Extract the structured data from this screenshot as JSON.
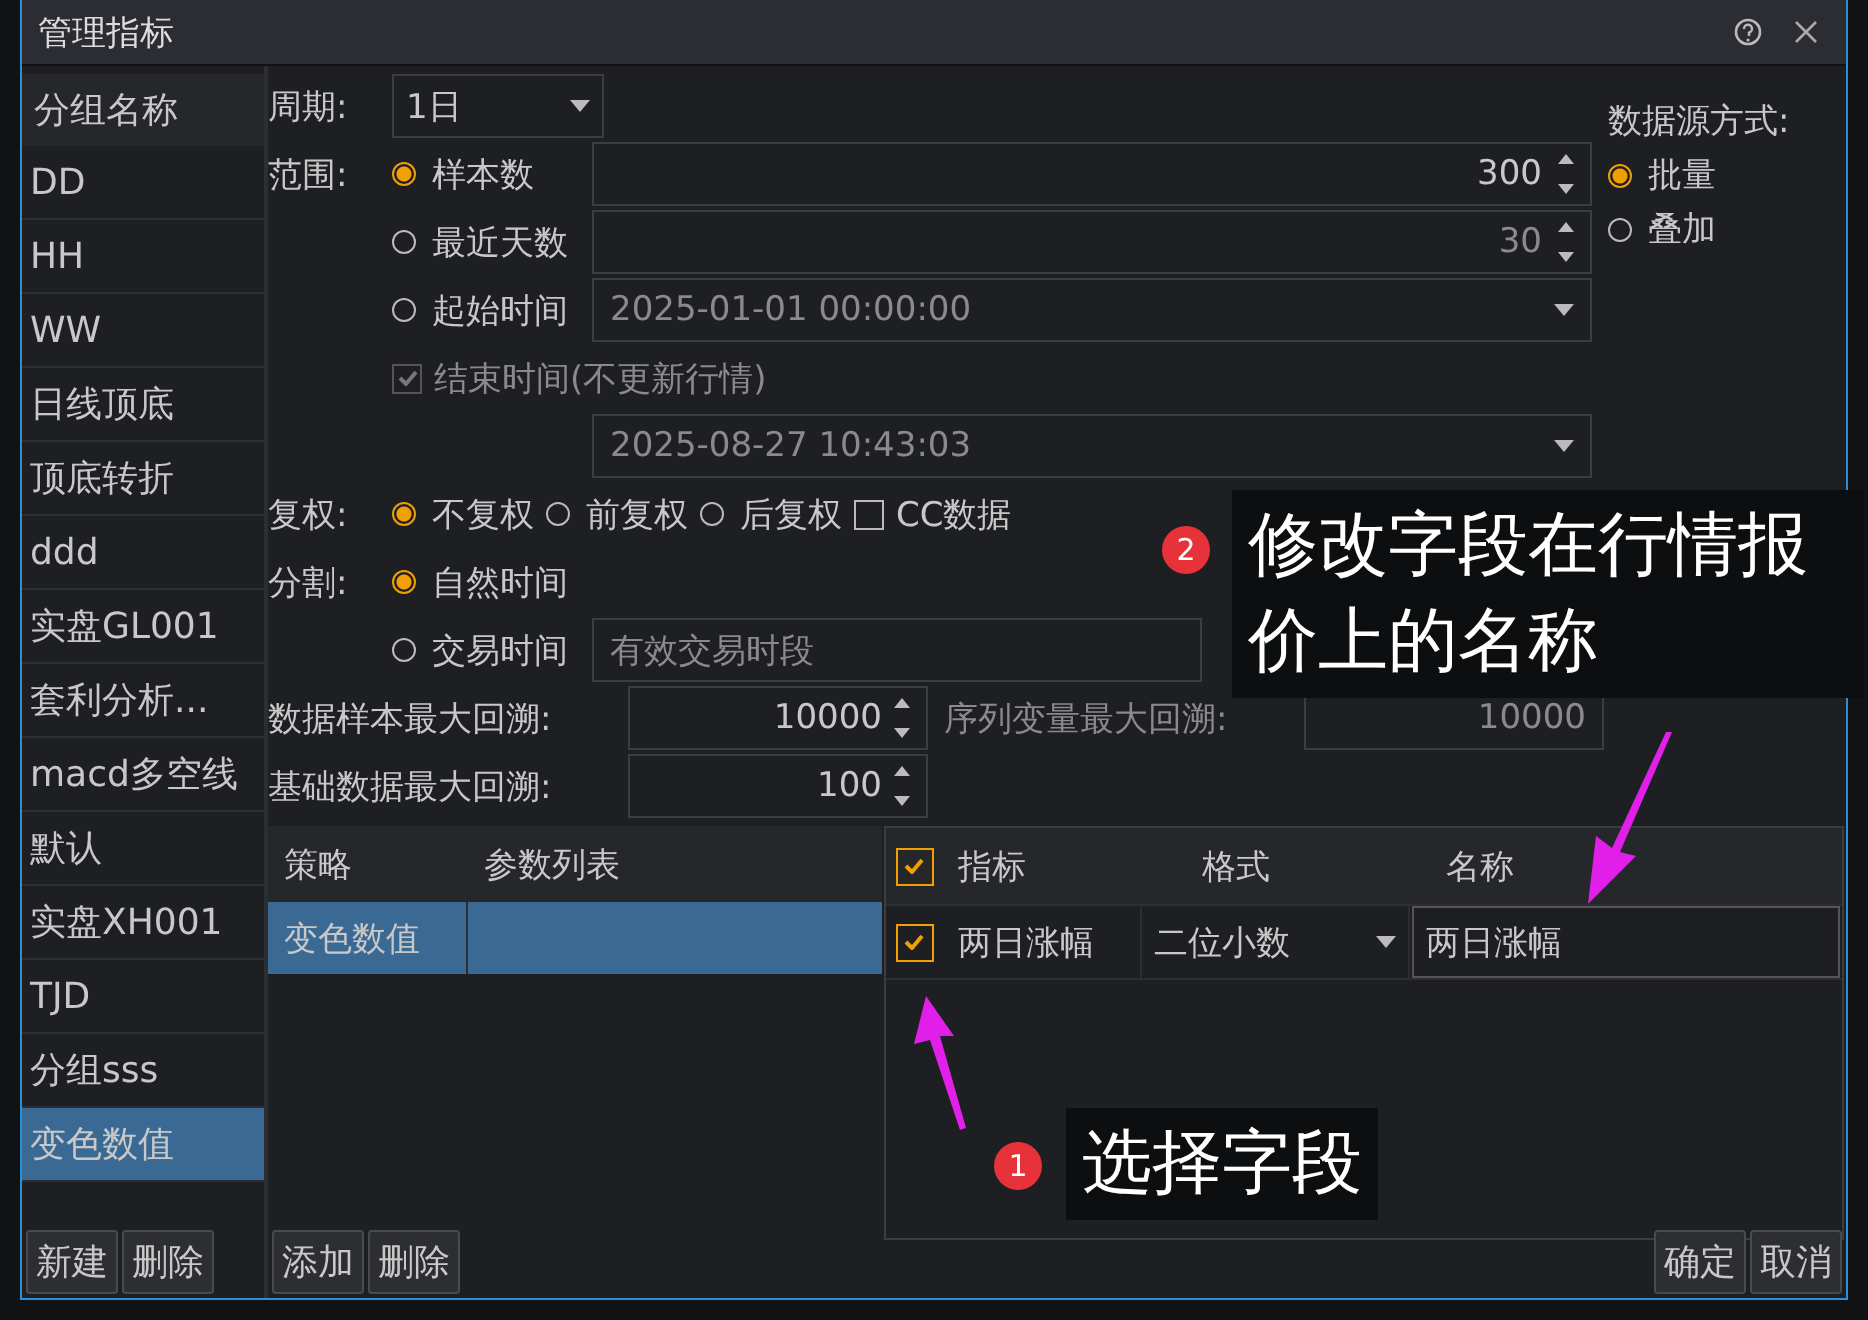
{
  "window": {
    "title": "管理指标"
  },
  "groups": {
    "header": "分组名称",
    "items": [
      {
        "label": "DD",
        "selected": false
      },
      {
        "label": "HH",
        "selected": false
      },
      {
        "label": "WW",
        "selected": false
      },
      {
        "label": "日线顶底",
        "selected": false
      },
      {
        "label": "顶底转折",
        "selected": false
      },
      {
        "label": "ddd",
        "selected": false
      },
      {
        "label": "实盘GL001",
        "selected": false
      },
      {
        "label": "套利分析...",
        "selected": false
      },
      {
        "label": "macd多空线",
        "selected": false
      },
      {
        "label": "默认",
        "selected": false
      },
      {
        "label": "实盘XH001",
        "selected": false
      },
      {
        "label": "TJD",
        "selected": false
      },
      {
        "label": "分组sss",
        "selected": false
      },
      {
        "label": "变色数值",
        "selected": true
      }
    ]
  },
  "period": {
    "label": "周期:",
    "value": "1日"
  },
  "range": {
    "label": "范围:",
    "options": [
      {
        "kind": "spin",
        "label": "样本数",
        "selected": true,
        "value": "300",
        "disabled": false
      },
      {
        "kind": "spin",
        "label": "最近天数",
        "selected": false,
        "value": "30",
        "disabled": true
      },
      {
        "kind": "date",
        "label": "起始时间",
        "selected": false,
        "value": "2025-01-01 00:00:00",
        "disabled": true
      }
    ],
    "end": {
      "label": "结束时间(不更新行情)",
      "checked": true,
      "disabled": true,
      "value": "2025-08-27 10:43:03"
    }
  },
  "source": {
    "label": "数据源方式:",
    "options": [
      {
        "label": "批量",
        "selected": true
      },
      {
        "label": "叠加",
        "selected": false
      }
    ]
  },
  "adjust": {
    "label": "复权:",
    "options": [
      {
        "label": "不复权",
        "selected": true
      },
      {
        "label": "前复权",
        "selected": false
      },
      {
        "label": "后复权",
        "selected": false
      }
    ],
    "cc": {
      "label": "CC数据",
      "checked": false
    }
  },
  "split": {
    "label": "分割:",
    "options": [
      {
        "label": "自然时间",
        "selected": true
      },
      {
        "label": "交易时间",
        "selected": false,
        "value": "有效交易时段"
      }
    ]
  },
  "lookback": [
    {
      "label": "数据样本最大回溯:",
      "value": "10000"
    },
    {
      "label": "基础数据最大回溯:",
      "value": "100"
    }
  ],
  "series_lookback": {
    "label": "序列变量最大回溯:",
    "value": "10000",
    "disabled": true
  },
  "strategy_table": {
    "columns": [
      "策略",
      "参数列表"
    ],
    "rows": [
      {
        "strategy": "变色数值",
        "selected": true
      }
    ]
  },
  "field_table": {
    "header_checked": true,
    "columns": [
      "指标",
      "格式",
      "名称"
    ],
    "rows": [
      {
        "checked": true,
        "indicator": "两日涨幅",
        "format": "二位小数",
        "name": "两日涨幅"
      }
    ]
  },
  "group_buttons": [
    "新建",
    "删除"
  ],
  "strategy_buttons": [
    "添加",
    "删除"
  ],
  "dialog_buttons": [
    "确定",
    "取消"
  ],
  "callouts": [
    {
      "number": "2",
      "text": "修改字段在行情报价上的名称"
    },
    {
      "number": "1",
      "text": "选择字段"
    }
  ]
}
